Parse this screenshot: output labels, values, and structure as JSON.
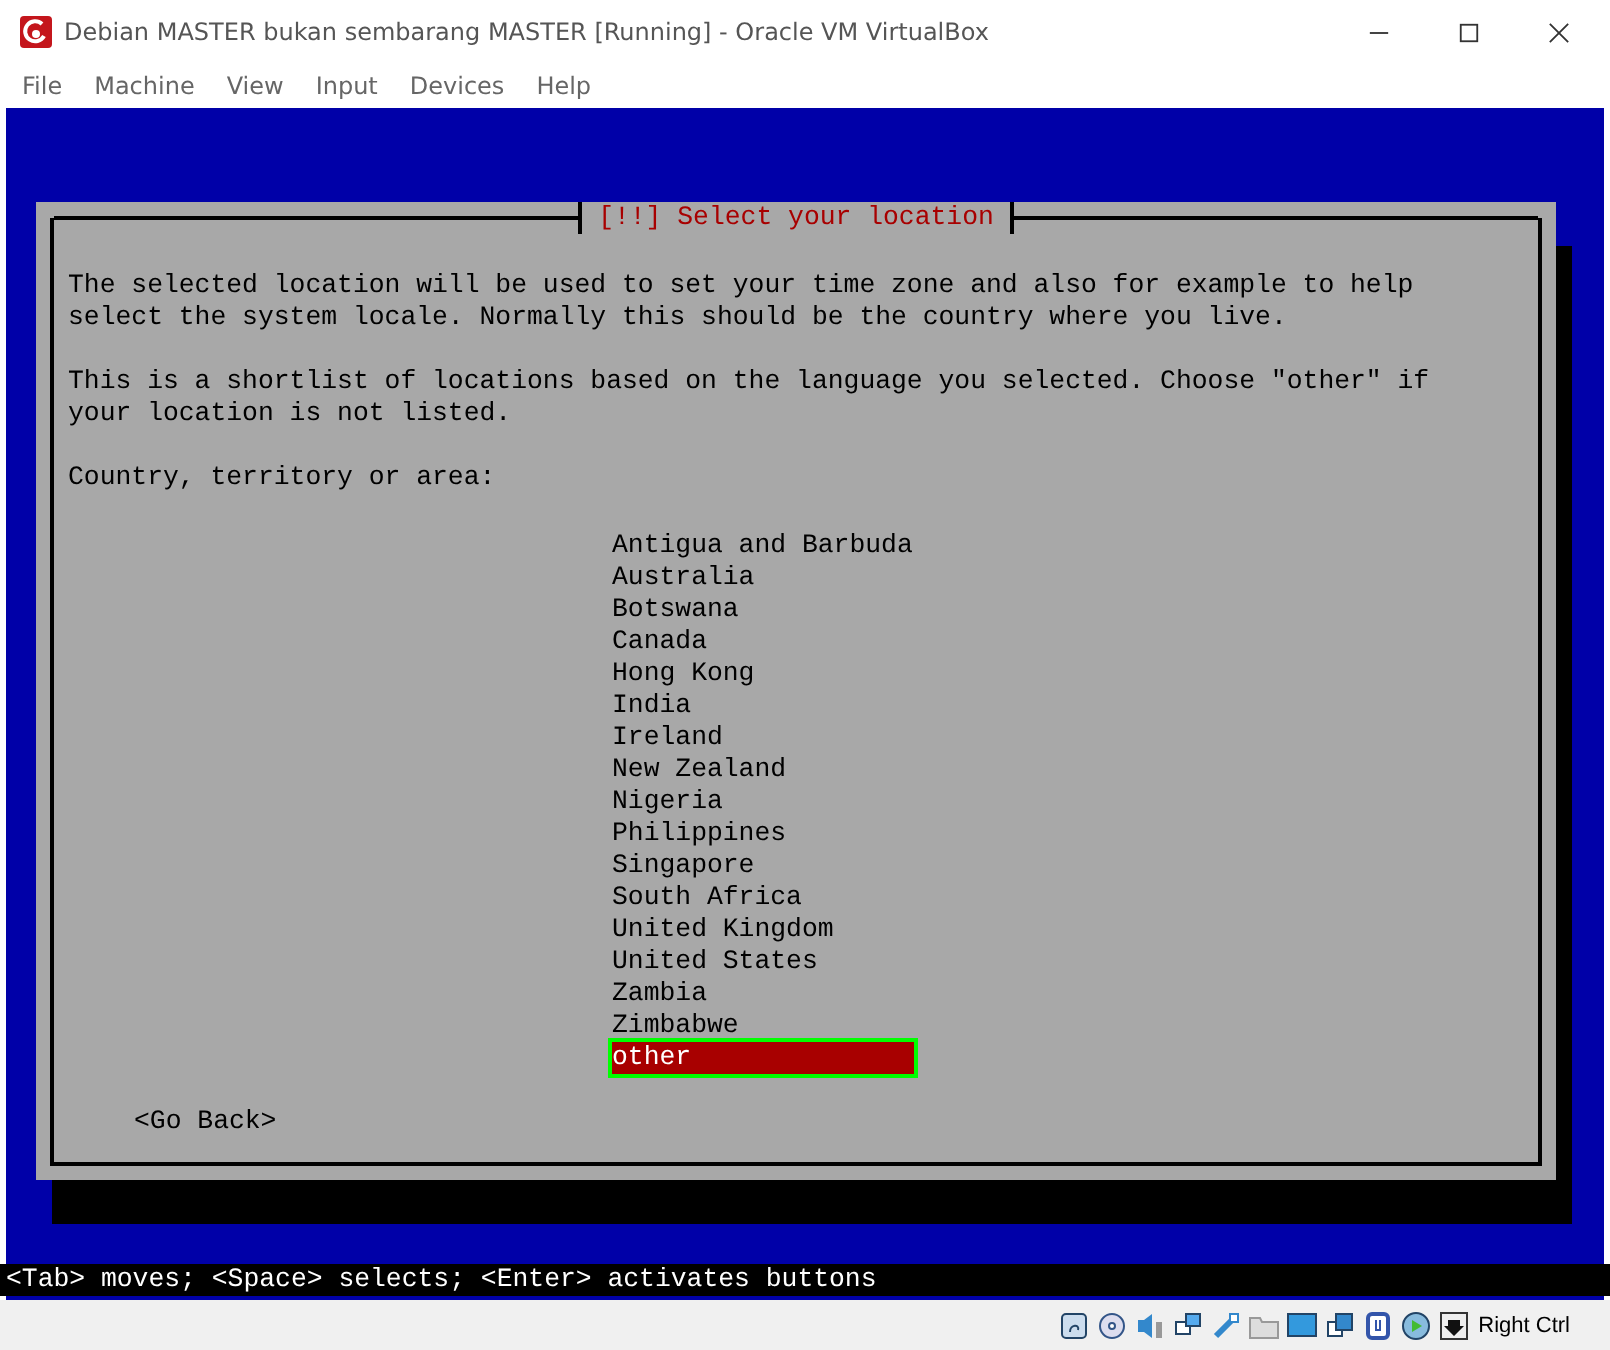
{
  "window": {
    "title": "Debian MASTER bukan sembarang MASTER [Running] - Oracle VM VirtualBox"
  },
  "menu": [
    "File",
    "Machine",
    "View",
    "Input",
    "Devices",
    "Help"
  ],
  "dialog": {
    "title": "[!!] Select your location",
    "paragraphs": [
      "The selected location will be used to set your time zone and also for example to help select the system locale. Normally this should be the country where you live.",
      "This is a shortlist of locations based on the language you selected. Choose \"other\" if your location is not listed."
    ],
    "prompt": "Country, territory or area:",
    "options": [
      {
        "label": "Antigua and Barbuda",
        "selected": false
      },
      {
        "label": "Australia",
        "selected": false
      },
      {
        "label": "Botswana",
        "selected": false
      },
      {
        "label": "Canada",
        "selected": false
      },
      {
        "label": "Hong Kong",
        "selected": false
      },
      {
        "label": "India",
        "selected": false
      },
      {
        "label": "Ireland",
        "selected": false
      },
      {
        "label": "New Zealand",
        "selected": false
      },
      {
        "label": "Nigeria",
        "selected": false
      },
      {
        "label": "Philippines",
        "selected": false
      },
      {
        "label": "Singapore",
        "selected": false
      },
      {
        "label": "South Africa",
        "selected": false
      },
      {
        "label": "United Kingdom",
        "selected": false
      },
      {
        "label": "United States",
        "selected": false
      },
      {
        "label": "Zambia",
        "selected": false
      },
      {
        "label": "Zimbabwe",
        "selected": false
      },
      {
        "label": "other",
        "selected": true
      }
    ],
    "back_button": "<Go Back>"
  },
  "help_line": "<Tab> moves; <Space> selects; <Enter> activates buttons",
  "status_bar": {
    "host_key": "Right Ctrl"
  }
}
